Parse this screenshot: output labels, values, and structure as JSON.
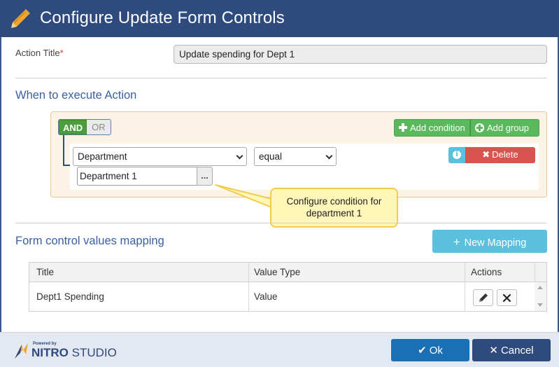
{
  "window": {
    "title": "Configure Update Form Controls",
    "icon": "pencil-icon"
  },
  "action_title": {
    "label": "Action Title",
    "required_mark": "*",
    "value": "Update spending for Dept 1"
  },
  "when_section": {
    "heading": "When to execute Action",
    "logic": {
      "and_label": "AND",
      "or_label": "OR",
      "selected": "AND"
    },
    "add_condition_label": "Add condition",
    "add_group_label": "Add group",
    "condition": {
      "field": "Department",
      "operator": "equal",
      "value": "Department 1",
      "browse_label": "...",
      "info_icon": "info-icon",
      "delete_label": "Delete"
    },
    "callout": "Configure condition for department 1"
  },
  "mapping_section": {
    "heading": "Form control values mapping",
    "new_mapping_label": "New Mapping",
    "columns": [
      "Title",
      "Value Type",
      "Actions"
    ],
    "rows": [
      {
        "title": "Dept1 Spending",
        "value_type": "Value"
      }
    ]
  },
  "footer": {
    "powered_by": "Powered by",
    "brand_bold": "NITRO",
    "brand_rest": " STUDIO",
    "ok_label": "Ok",
    "cancel_label": "Cancel"
  },
  "colors": {
    "titlebar": "#2f4a7c",
    "accent_green": "#5cb85c",
    "accent_info": "#5bc0de",
    "danger": "#d9534f",
    "primary": "#1a6fb5",
    "section_heading": "#3b5fa3",
    "callout_bg": "#fff6b8"
  }
}
